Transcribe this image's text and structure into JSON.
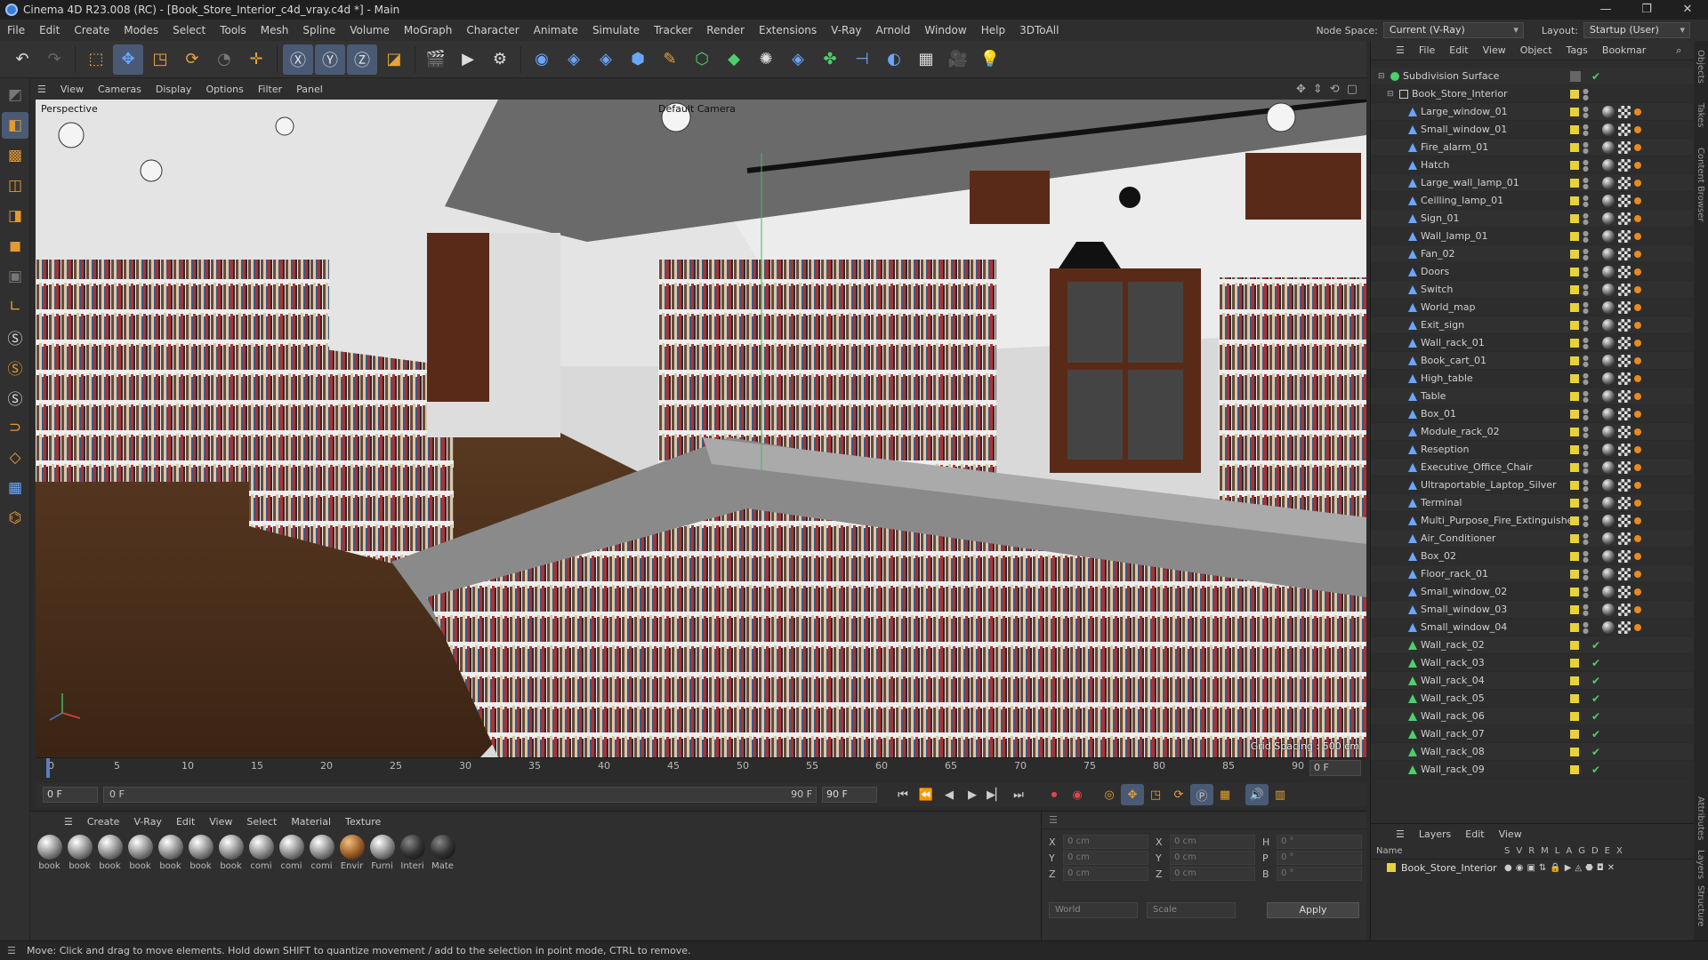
{
  "window": {
    "title": "Cinema 4D R23.008 (RC) - [Book_Store_Interior_c4d_vray.c4d *] - Main"
  },
  "menubar": {
    "items": [
      "File",
      "Edit",
      "Create",
      "Modes",
      "Select",
      "Tools",
      "Mesh",
      "Spline",
      "Volume",
      "MoGraph",
      "Character",
      "Animate",
      "Simulate",
      "Tracker",
      "Render",
      "Extensions",
      "V-Ray",
      "Arnold",
      "Window",
      "Help",
      "3DToAll"
    ],
    "node_space_label": "Node Space:",
    "node_space_value": "Current (V-Ray)",
    "layout_label": "Layout:",
    "layout_value": "Startup (User)"
  },
  "viewport": {
    "menu": [
      "View",
      "Cameras",
      "Display",
      "Options",
      "Filter",
      "Panel"
    ],
    "projection": "Perspective",
    "camera": "Default Camera",
    "grid_spacing": "Grid Spacing : 500 cm"
  },
  "timeline": {
    "ticks": [
      "0",
      "5",
      "10",
      "15",
      "20",
      "25",
      "30",
      "35",
      "40",
      "45",
      "50",
      "55",
      "60",
      "65",
      "70",
      "75",
      "80",
      "85",
      "90"
    ],
    "current_frame": "0 F"
  },
  "playback": {
    "start": "0 F",
    "min": "0 F",
    "max": "90 F",
    "end": "90 F"
  },
  "material_manager": {
    "menu": [
      "Create",
      "V-Ray",
      "Edit",
      "View",
      "Select",
      "Material",
      "Texture"
    ],
    "materials": [
      {
        "label": "book",
        "style": "white"
      },
      {
        "label": "book",
        "style": "white"
      },
      {
        "label": "book",
        "style": "white"
      },
      {
        "label": "book",
        "style": "white"
      },
      {
        "label": "book",
        "style": "white"
      },
      {
        "label": "book",
        "style": "white"
      },
      {
        "label": "book",
        "style": "white"
      },
      {
        "label": "comi",
        "style": "white"
      },
      {
        "label": "comi",
        "style": "white"
      },
      {
        "label": "comi",
        "style": "white"
      },
      {
        "label": "Envir",
        "style": "brown"
      },
      {
        "label": "Furni",
        "style": "white"
      },
      {
        "label": "Interi",
        "style": "dark"
      },
      {
        "label": "Mate",
        "style": "dark"
      }
    ]
  },
  "coordinates": {
    "rows": [
      {
        "a": "X",
        "av": "0 cm",
        "b": "X",
        "bv": "0 cm",
        "c": "H",
        "cv": "0 °"
      },
      {
        "a": "Y",
        "av": "0 cm",
        "b": "Y",
        "bv": "0 cm",
        "c": "P",
        "cv": "0 °"
      },
      {
        "a": "Z",
        "av": "0 cm",
        "b": "Z",
        "bv": "0 cm",
        "c": "B",
        "cv": "0 °"
      }
    ],
    "mode1": "World",
    "mode2": "Scale",
    "apply": "Apply"
  },
  "status": {
    "text": "Move: Click and drag to move elements. Hold down SHIFT to quantize movement / add to the selection in point mode, CTRL to remove."
  },
  "object_manager": {
    "menu": [
      "File",
      "Edit",
      "View",
      "Object",
      "Tags",
      "Bookmar"
    ],
    "root": "Subdivision Surface",
    "group": "Book_Store_Interior",
    "objects": [
      {
        "name": "Large_window_01",
        "tags": "full"
      },
      {
        "name": "Small_window_01",
        "tags": "full"
      },
      {
        "name": "Fire_alarm_01",
        "tags": "full"
      },
      {
        "name": "Hatch",
        "tags": "full"
      },
      {
        "name": "Large_wall_lamp_01",
        "tags": "full"
      },
      {
        "name": "Ceilling_lamp_01",
        "tags": "full"
      },
      {
        "name": "Sign_01",
        "tags": "full"
      },
      {
        "name": "Wall_lamp_01",
        "tags": "full"
      },
      {
        "name": "Fan_02",
        "tags": "full"
      },
      {
        "name": "Doors",
        "tags": "full"
      },
      {
        "name": "Switch",
        "tags": "full"
      },
      {
        "name": "World_map",
        "tags": "full"
      },
      {
        "name": "Exit_sign",
        "tags": "full"
      },
      {
        "name": "Wall_rack_01",
        "tags": "full"
      },
      {
        "name": "Book_cart_01",
        "tags": "full"
      },
      {
        "name": "High_table",
        "tags": "full"
      },
      {
        "name": "Table",
        "tags": "full"
      },
      {
        "name": "Box_01",
        "tags": "full"
      },
      {
        "name": "Module_rack_02",
        "tags": "full"
      },
      {
        "name": "Reseption",
        "tags": "full"
      },
      {
        "name": "Executive_Office_Chair",
        "tags": "full"
      },
      {
        "name": "Ultraportable_Laptop_Silver",
        "tags": "full"
      },
      {
        "name": "Terminal",
        "tags": "full"
      },
      {
        "name": "Multi_Purpose_Fire_Extinguisher",
        "tags": "full"
      },
      {
        "name": "Air_Conditioner",
        "tags": "full"
      },
      {
        "name": "Box_02",
        "tags": "full"
      },
      {
        "name": "Floor_rack_01",
        "tags": "full"
      },
      {
        "name": "Small_window_02",
        "tags": "full"
      },
      {
        "name": "Small_window_03",
        "tags": "full"
      },
      {
        "name": "Small_window_04",
        "tags": "full"
      },
      {
        "name": "Wall_rack_02",
        "tags": "check"
      },
      {
        "name": "Wall_rack_03",
        "tags": "check"
      },
      {
        "name": "Wall_rack_04",
        "tags": "check"
      },
      {
        "name": "Wall_rack_05",
        "tags": "check"
      },
      {
        "name": "Wall_rack_06",
        "tags": "check"
      },
      {
        "name": "Wall_rack_07",
        "tags": "check"
      },
      {
        "name": "Wall_rack_08",
        "tags": "check"
      },
      {
        "name": "Wall_rack_09",
        "tags": "check"
      }
    ]
  },
  "layers": {
    "menu": [
      "Layers",
      "Edit",
      "View"
    ],
    "header_name": "Name",
    "header_cols": [
      "S",
      "V",
      "R",
      "M",
      "L",
      "A",
      "G",
      "D",
      "E",
      "X"
    ],
    "rows": [
      "Book_Store_Interior"
    ]
  },
  "side_tabs": [
    "Objects",
    "Takes",
    "Content Browser",
    "Attributes",
    "Layers",
    "Structure"
  ]
}
